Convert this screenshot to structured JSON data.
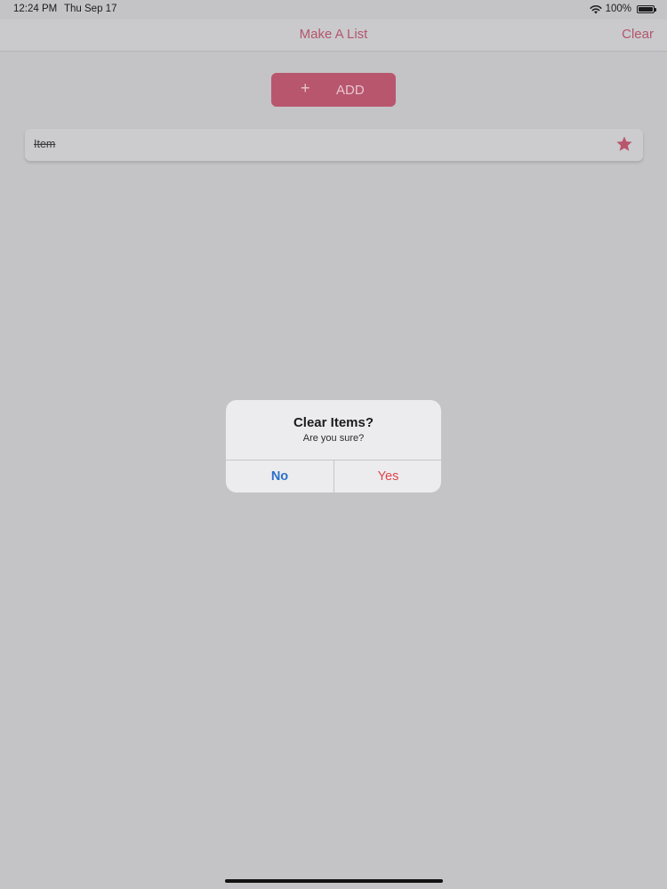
{
  "status_bar": {
    "time": "12:24 PM",
    "date": "Thu Sep 17",
    "battery": "100%"
  },
  "nav": {
    "title": "Make A List",
    "clear_label": "Clear"
  },
  "add_button": {
    "icon": "+",
    "label": "ADD"
  },
  "list": {
    "items": [
      {
        "label": "Item",
        "completed": true,
        "starred": true
      }
    ]
  },
  "alert": {
    "title": "Clear Items?",
    "message": "Are you sure?",
    "no_label": "No",
    "yes_label": "Yes"
  },
  "colors": {
    "accent": "#b8566e",
    "no_button": "#2a6fc9",
    "yes_button": "#e0454a"
  }
}
